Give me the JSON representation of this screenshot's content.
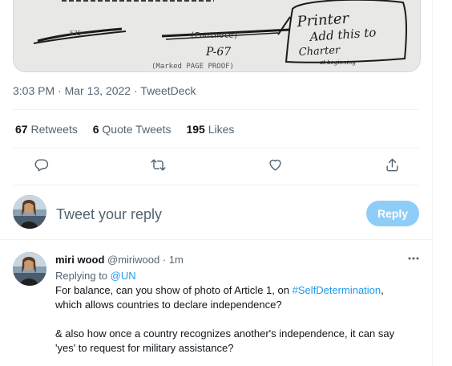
{
  "media": {
    "handwriting": [
      "Printer",
      "Add this to",
      "Charter",
      "at beginning"
    ],
    "typed_fragments": [
      "(Footnote)",
      "P-67",
      "(Marked PAGE PROOF)",
      "535"
    ]
  },
  "tweet_meta": {
    "time": "3:03 PM",
    "sep1": " · ",
    "date": "Mar 13, 2022",
    "sep2": " · ",
    "source": "TweetDeck"
  },
  "stats": {
    "retweets_count": "67",
    "retweets_label": "Retweets",
    "quotes_count": "6",
    "quotes_label": "Quote Tweets",
    "likes_count": "195",
    "likes_label": "Likes"
  },
  "actions": [
    {
      "name": "reply",
      "icon": "reply-icon"
    },
    {
      "name": "retweet",
      "icon": "retweet-icon"
    },
    {
      "name": "like",
      "icon": "heart-icon"
    },
    {
      "name": "share",
      "icon": "share-icon"
    }
  ],
  "compose": {
    "placeholder": "Tweet your reply",
    "button_label": "Reply"
  },
  "reply": {
    "display_name": "miri wood",
    "handle": "@miriwood",
    "separator": " · ",
    "time": "1m",
    "replying_prefix": "Replying to ",
    "replying_to": "@UN",
    "line1_before": "For balance, can you show of photo of Article 1, on ",
    "line1_hashtag": "#SelfDetermination",
    "line1_after": ", which allows countries to declare independence?",
    "paragraph2": "& also how once a country recognizes another's independence, it can say 'yes' to request for military assistance?"
  },
  "colors": {
    "accent": "#1d9bf0",
    "reply_button_disabled": "#8ecdf8",
    "secondary_text": "#536471",
    "divider": "#eff3f4"
  }
}
